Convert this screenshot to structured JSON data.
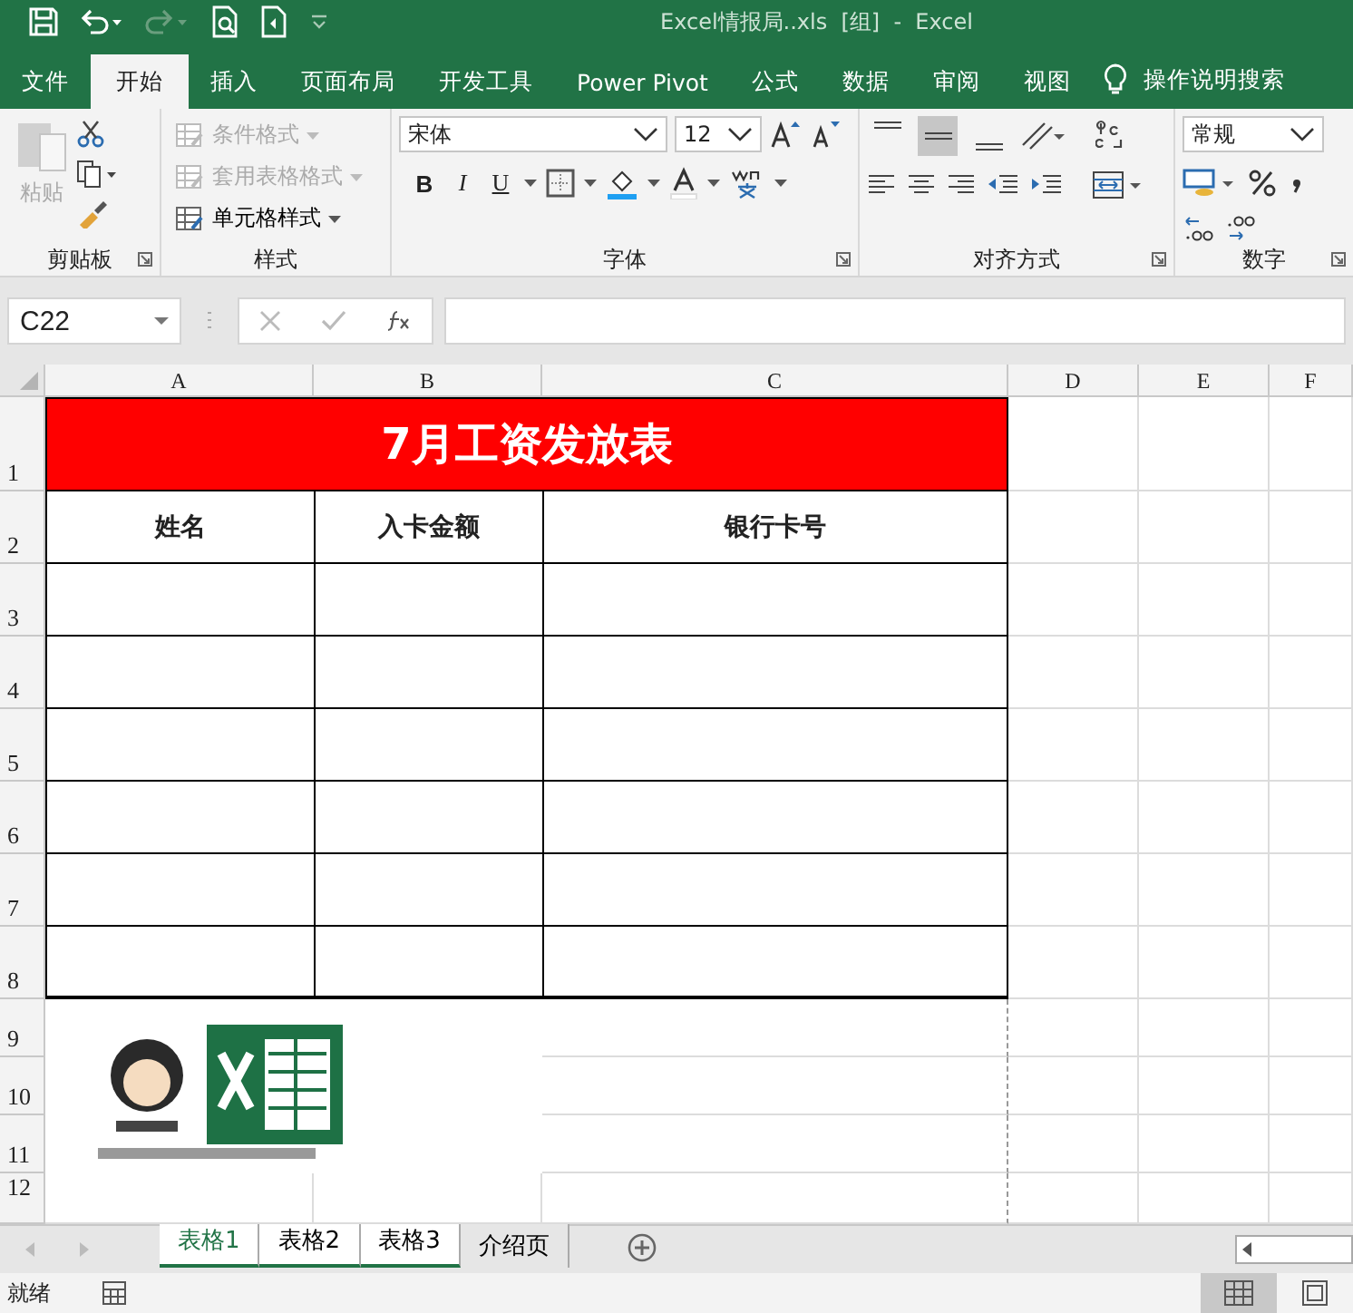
{
  "window": {
    "title": "Excel情报局..xls  [组]  -  Excel"
  },
  "ribbon_tabs": [
    {
      "label": "文件",
      "selected": false
    },
    {
      "label": "开始",
      "selected": true
    },
    {
      "label": "插入",
      "selected": false
    },
    {
      "label": "页面布局",
      "selected": false
    },
    {
      "label": "开发工具",
      "selected": false
    },
    {
      "label": "Power Pivot",
      "selected": false
    },
    {
      "label": "公式",
      "selected": false
    },
    {
      "label": "数据",
      "selected": false
    },
    {
      "label": "审阅",
      "selected": false
    },
    {
      "label": "视图",
      "selected": false
    }
  ],
  "tell_me": "操作说明搜索",
  "clipboard": {
    "label": "剪贴板",
    "paste": "粘贴",
    "paste_disabled": true
  },
  "styles": {
    "label": "样式",
    "items": [
      {
        "label": "条件格式",
        "disabled": true
      },
      {
        "label": "套用表格格式",
        "disabled": true
      },
      {
        "label": "单元格样式",
        "disabled": false
      }
    ]
  },
  "font": {
    "label": "字体",
    "name": "宋体",
    "size": "12",
    "styles": [
      "B",
      "I",
      "U"
    ]
  },
  "alignment": {
    "label": "对齐方式",
    "vertical": [
      {
        "selected": false
      },
      {
        "selected": true
      },
      {
        "selected": false
      }
    ]
  },
  "number": {
    "label": "数字",
    "format": "常规"
  },
  "formula_bar": {
    "name_box": "C22"
  },
  "sheet": {
    "columns": [
      "A",
      "B",
      "C",
      "D",
      "E",
      "F"
    ],
    "rows": [
      "1",
      "2",
      "3",
      "4",
      "5",
      "6",
      "7",
      "8",
      "9",
      "10",
      "11",
      "12"
    ],
    "title": "7月工资发放表",
    "headers": [
      "姓名",
      "入卡金额",
      "银行卡号"
    ]
  },
  "sheet_tabs": [
    {
      "label": "表格1",
      "selected": true,
      "grouped": true
    },
    {
      "label": "表格2",
      "selected": false,
      "grouped": true
    },
    {
      "label": "表格3",
      "selected": false,
      "grouped": true
    },
    {
      "label": "介绍页",
      "selected": false,
      "grouped": false
    }
  ],
  "status_bar": {
    "text": "就绪"
  }
}
